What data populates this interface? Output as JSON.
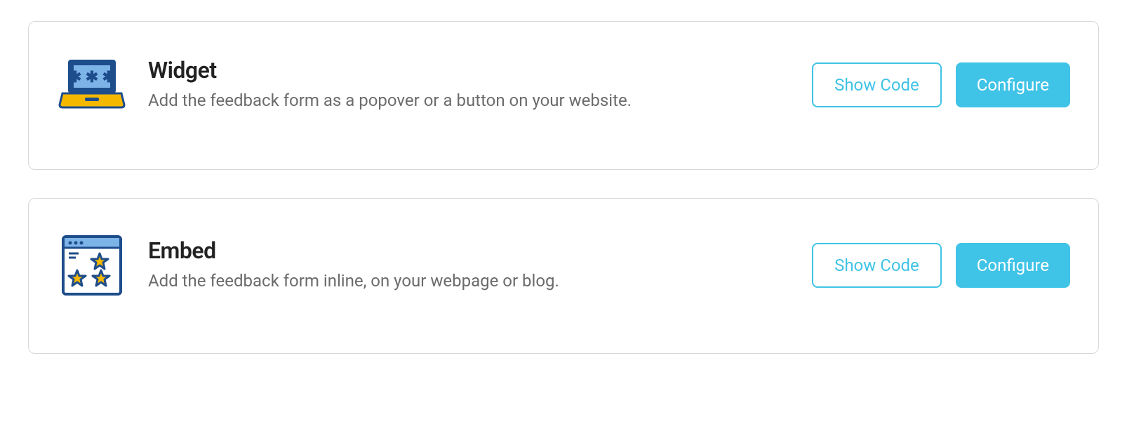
{
  "cards": [
    {
      "title": "Widget",
      "description": "Add the feedback form as a popover or a button on your website.",
      "show_code_label": "Show Code",
      "configure_label": "Configure"
    },
    {
      "title": "Embed",
      "description": "Add the feedback form inline, on your webpage or blog.",
      "show_code_label": "Show Code",
      "configure_label": "Configure"
    }
  ],
  "colors": {
    "accent": "#3fc3e6",
    "border": "#d8d8d8",
    "title": "#222222",
    "description": "#6b6b6b",
    "icon_blue": "#1e4d8b",
    "icon_light_blue": "#7db4e8",
    "icon_yellow": "#f5b800"
  }
}
